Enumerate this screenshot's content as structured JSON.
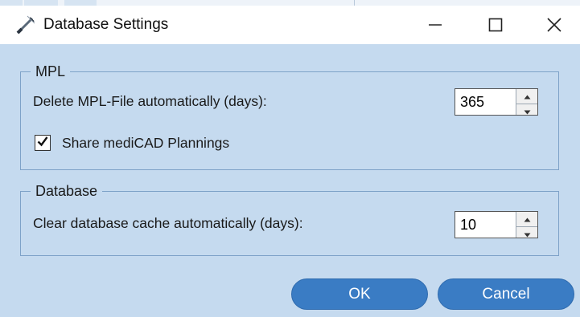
{
  "window": {
    "title": "Database Settings",
    "icons": {
      "app": "syringe-icon",
      "minimize": "minimize-icon",
      "maximize": "maximize-icon",
      "close": "close-icon"
    }
  },
  "mpl_group": {
    "legend": "MPL",
    "delete_label": "Delete MPL-File automatically (days):",
    "delete_days": "365",
    "share_label": "Share mediCAD Plannings",
    "share_checked": true
  },
  "database_group": {
    "legend": "Database",
    "cache_label": "Clear database cache automatically (days):",
    "cache_days": "10"
  },
  "buttons": {
    "ok": "OK",
    "cancel": "Cancel"
  },
  "colors": {
    "background": "#c5daef",
    "accent": "#3a7cc4",
    "titlebar": "#ffffff"
  }
}
